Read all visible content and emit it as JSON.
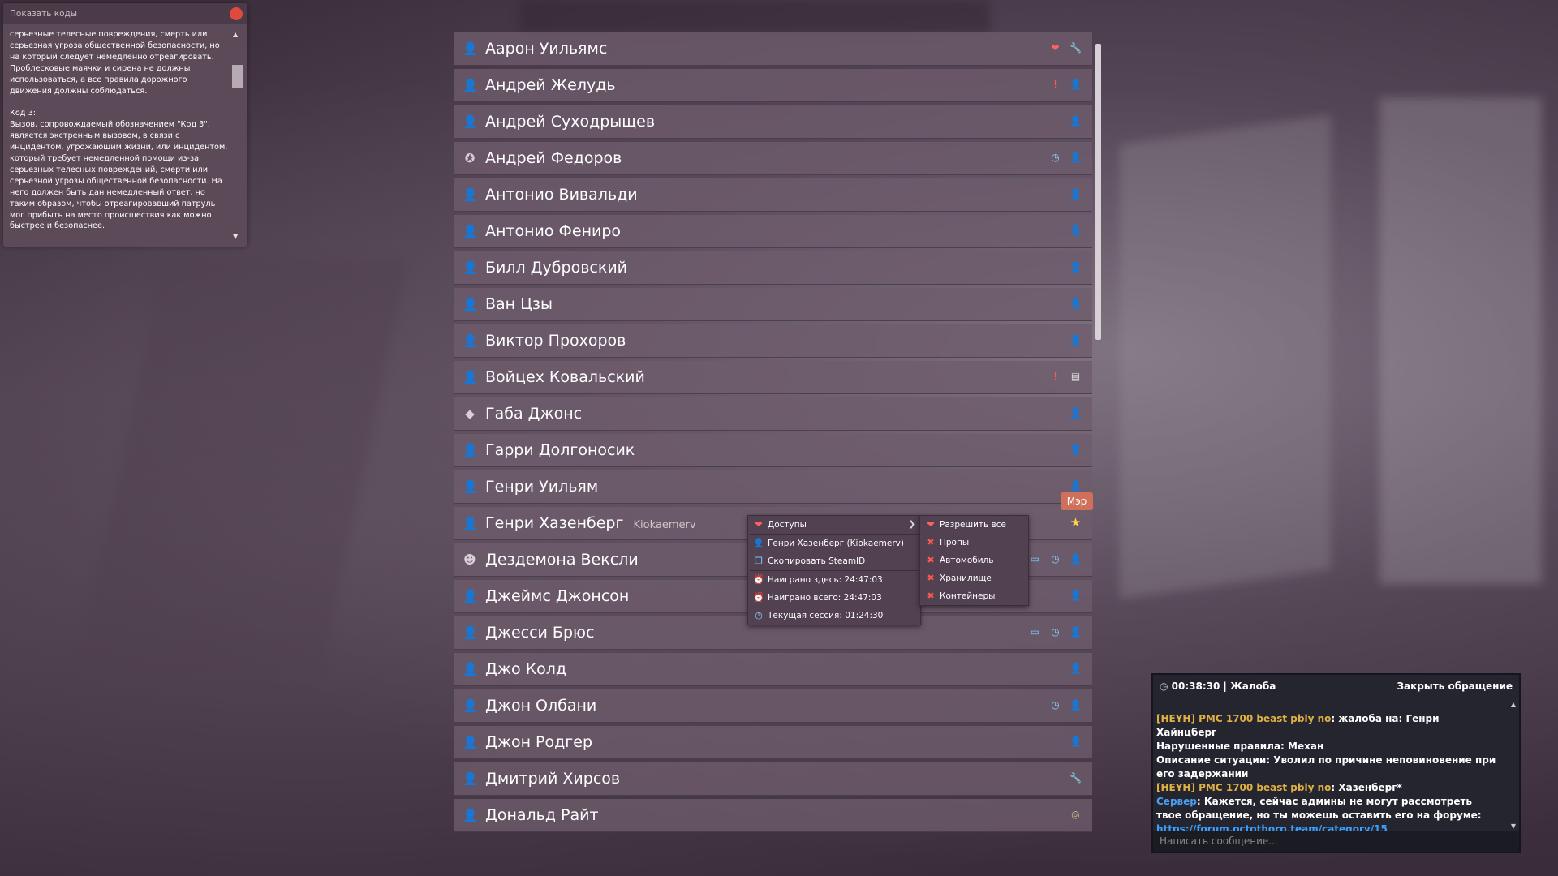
{
  "codes_panel": {
    "title": "Показать коды",
    "text": "серьезные телесные повреждения, смерть или серьезная угроза общественной безопасности, но на который следует немедленно отреагировать. Проблесковые маячки и сирена не должны использоваться, а все правила дорожного движения должны соблюдаться.\n\nКод 3:\nВызов, сопровождаемый обозначением \"Код 3\", является экстренным вызовом, в связи с инцидентом, угрожающим жизни, или инцидентом, который требует немедленной помощи из-за серьезных телесных повреждений, смерти или серьезной угрозы общественной безопасности. На него должен быть дан немедленный ответ, но таким образом, чтобы отреагировавший патруль мог прибыть на место происшествия как можно быстрее и безопаснее."
  },
  "players": [
    {
      "name": "Аарон Уильямс",
      "avatar": "user-icon",
      "icons": [
        "heart-icon",
        "wrench-icon"
      ]
    },
    {
      "name": "Андрей Желудь",
      "avatar": "user-icon",
      "icons": [
        "warning-icon",
        "user-icon"
      ]
    },
    {
      "name": "Андрей Суходрыщев",
      "avatar": "user-icon",
      "icons": [
        "user-icon"
      ]
    },
    {
      "name": "Андрей Федоров",
      "avatar": "medal-icon",
      "icons": [
        "clock-icon",
        "user-icon"
      ]
    },
    {
      "name": "Антонио Вивальди",
      "avatar": "user-icon",
      "icons": [
        "user-icon"
      ]
    },
    {
      "name": "Антонио Фениро",
      "avatar": "user-icon",
      "icons": [
        "user-icon"
      ]
    },
    {
      "name": "Билл Дубровский",
      "avatar": "user-icon",
      "icons": [
        "user-icon"
      ]
    },
    {
      "name": "Ван Цзы",
      "avatar": "user-icon",
      "icons": [
        "user-icon"
      ]
    },
    {
      "name": "Виктор Прохоров",
      "avatar": "user-icon",
      "icons": [
        "user-icon"
      ]
    },
    {
      "name": "Войцех Ковальский",
      "avatar": "user-icon",
      "icons": [
        "warning-icon",
        "document-icon"
      ]
    },
    {
      "name": "Габа Джонс",
      "avatar": "gem-icon",
      "icons": [
        "user-icon"
      ]
    },
    {
      "name": "Гарри Долгоносик",
      "avatar": "user-icon",
      "icons": [
        "user-icon"
      ]
    },
    {
      "name": "Генри Уильям",
      "avatar": "user-icon",
      "icons": [
        "user-icon"
      ]
    },
    {
      "name": "Генри Хазенберг",
      "steam": "Kiokaemerv",
      "avatar": "user-icon",
      "icons": [
        "star-icon"
      ]
    },
    {
      "name": "Дездемона Вексли",
      "avatar": "mask-icon",
      "icons": [
        "monitor-icon",
        "clock-icon",
        "user-icon"
      ]
    },
    {
      "name": "Джеймс Джонсон",
      "avatar": "user-icon",
      "icons": [
        "user-icon"
      ]
    },
    {
      "name": "Джесси Брюс",
      "avatar": "user-icon",
      "icons": [
        "monitor-icon",
        "clock-icon",
        "user-icon"
      ]
    },
    {
      "name": "Джо Колд",
      "avatar": "user-icon",
      "icons": [
        "user-icon"
      ]
    },
    {
      "name": "Джон Олбани",
      "avatar": "user-icon",
      "icons": [
        "clock-icon",
        "user-icon"
      ]
    },
    {
      "name": "Джон Родгер",
      "avatar": "user-icon",
      "icons": [
        "user-icon"
      ]
    },
    {
      "name": "Дмитрий Хирсов",
      "avatar": "user-icon",
      "icons": [
        "wrench-icon"
      ]
    },
    {
      "name": "Дональд Райт",
      "avatar": "user-icon",
      "icons": [
        "ring-icon"
      ]
    }
  ],
  "tooltip": "Мэр",
  "context_menu": {
    "items": [
      {
        "label": "Доступы",
        "icon": "heart-icon",
        "submenu": true
      },
      {
        "label": "Генри Хазенберг (Kiokaemerv)",
        "icon": "user-icon"
      },
      {
        "label": "Скопировать SteamID",
        "icon": "copy-icon"
      },
      {
        "label": "Наиграно здесь: 24:47:03",
        "icon": "alarm-icon"
      },
      {
        "label": "Наиграно всего: 24:47:03",
        "icon": "alarm-red-icon"
      },
      {
        "label": "Текущая сессия: 01:24:30",
        "icon": "clock-icon"
      }
    ]
  },
  "submenu": {
    "items": [
      {
        "label": "Разрешить все",
        "icon": "heart-icon"
      },
      {
        "label": "Пропы",
        "icon": "cross-icon"
      },
      {
        "label": "Автомобиль",
        "icon": "cross-icon"
      },
      {
        "label": "Хранилище",
        "icon": "cross-icon"
      },
      {
        "label": "Контейнеры",
        "icon": "cross-icon"
      }
    ]
  },
  "chat": {
    "header": "00:38:30 | Жалоба",
    "close_label": "Закрыть обращение",
    "messages": [
      {
        "author": "[HEYH] PMC 1700 beast pbly no",
        "author_color": "#e0b040",
        "text": ": жалоба на: Генри Хайнцберг"
      },
      {
        "author": "",
        "text": "Нарушенные правила: Механ"
      },
      {
        "author": "",
        "text": "Описание ситуации: Уволил по причине неповиновение при его задержании"
      },
      {
        "author": "[HEYH] PMC 1700 beast pbly no",
        "author_color": "#e0b040",
        "text": ": Хазенберг*"
      },
      {
        "author": "Сервер",
        "author_color": "#4a9ef0",
        "text": ": Кажется, сейчас админы не могут рассмотреть твое обращение, но ты можешь оставить его на форуме:"
      },
      {
        "author": "",
        "text": "",
        "link": "https://forum.octothorp.team/category/15"
      }
    ],
    "input_placeholder": "Написать сообщение..."
  }
}
